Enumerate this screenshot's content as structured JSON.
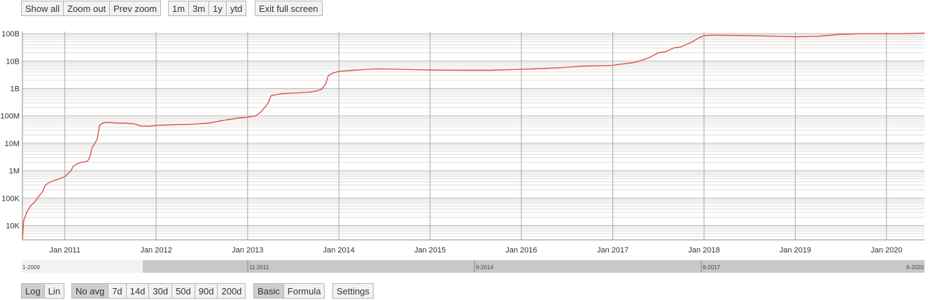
{
  "toolbar_top": {
    "zoom": [
      "Show all",
      "Zoom out",
      "Prev zoom"
    ],
    "ranges": [
      "1m",
      "3m",
      "1y",
      "ytd"
    ],
    "fullscreen": "Exit full screen"
  },
  "toolbar_bottom": {
    "scale": [
      "Log",
      "Lin"
    ],
    "averages": [
      "No avg",
      "7d",
      "14d",
      "30d",
      "50d",
      "90d",
      "200d"
    ],
    "mode": [
      "Basic",
      "Formula"
    ],
    "settings": "Settings",
    "active": [
      "Log",
      "No avg",
      "Basic"
    ]
  },
  "navigator": {
    "labels": [
      "1-2009",
      "11-2011",
      "9-2014",
      "8-2017",
      "6-2020"
    ]
  },
  "chart_data": {
    "type": "line",
    "yscale": "log",
    "ylim": [
      3000,
      120000000000
    ],
    "xlim": [
      "2010-07-15",
      "2020-06-01"
    ],
    "y_tick_labels": [
      "10K",
      "100K",
      "1M",
      "10M",
      "100M",
      "1B",
      "10B",
      "100B"
    ],
    "y_tick_values": [
      10000,
      100000,
      1000000,
      10000000,
      100000000,
      1000000000,
      10000000000,
      100000000000
    ],
    "x_tick_labels": [
      "Jan 2011",
      "Jan 2012",
      "Jan 2013",
      "Jan 2014",
      "Jan 2015",
      "Jan 2016",
      "Jan 2017",
      "Jan 2018",
      "Jan 2019",
      "Jan 2020"
    ],
    "x_tick_values": [
      "2011-01-01",
      "2012-01-01",
      "2013-01-01",
      "2014-01-01",
      "2015-01-01",
      "2016-01-01",
      "2017-01-01",
      "2018-01-01",
      "2019-01-01",
      "2020-01-01"
    ],
    "grid": true,
    "color": "#d9534f",
    "series": [
      {
        "x": [
          "2010-07-15",
          "2010-07-20",
          "2010-08-01",
          "2010-08-15",
          "2010-09-01",
          "2010-09-20",
          "2010-10-05",
          "2010-10-15",
          "2010-11-01",
          "2010-12-01",
          "2011-01-01",
          "2011-01-25",
          "2011-02-05",
          "2011-02-20",
          "2011-03-05",
          "2011-04-01",
          "2011-04-10",
          "2011-04-20",
          "2011-05-01",
          "2011-05-10",
          "2011-05-20",
          "2011-06-01",
          "2011-06-10",
          "2011-07-01",
          "2011-08-01",
          "2011-09-01",
          "2011-10-01",
          "2011-11-01",
          "2011-12-01",
          "2012-01-01",
          "2012-03-01",
          "2012-06-01",
          "2012-08-01",
          "2012-10-01",
          "2012-12-01",
          "2013-01-01",
          "2013-02-01",
          "2013-02-20",
          "2013-03-10",
          "2013-03-25",
          "2013-04-05",
          "2013-04-20",
          "2013-05-15",
          "2013-07-01",
          "2013-09-01",
          "2013-10-01",
          "2013-10-25",
          "2013-11-10",
          "2013-11-20",
          "2013-12-10",
          "2014-01-01",
          "2014-03-01",
          "2014-06-01",
          "2014-09-01",
          "2015-01-01",
          "2015-06-01",
          "2015-09-01",
          "2016-01-01",
          "2016-06-01",
          "2016-09-01",
          "2017-01-01",
          "2017-04-01",
          "2017-05-01",
          "2017-06-01",
          "2017-07-01",
          "2017-08-01",
          "2017-09-01",
          "2017-10-01",
          "2017-11-15",
          "2017-12-10",
          "2018-01-01",
          "2018-02-01",
          "2018-06-01",
          "2018-11-01",
          "2019-01-01",
          "2019-04-01",
          "2019-07-01",
          "2019-10-01",
          "2020-01-01",
          "2020-03-01",
          "2020-06-01"
        ],
        "y": [
          3000,
          15000,
          30000,
          50000,
          70000,
          120000,
          180000,
          300000,
          380000,
          480000,
          600000,
          1000000,
          1500000,
          1800000,
          2000000,
          2200000,
          3000000,
          7000000,
          10000000,
          14000000,
          45000000,
          55000000,
          58000000,
          57000000,
          55000000,
          54000000,
          52000000,
          43000000,
          42000000,
          45000000,
          47000000,
          50000000,
          55000000,
          70000000,
          85000000,
          90000000,
          100000000,
          130000000,
          200000000,
          300000000,
          550000000,
          580000000,
          640000000,
          680000000,
          720000000,
          800000000,
          950000000,
          1500000000,
          3000000000,
          3700000000,
          4200000000,
          4600000000,
          5200000000,
          5000000000,
          4700000000,
          4600000000,
          4600000000,
          5000000000,
          5700000000,
          6500000000,
          7000000000,
          9000000000,
          11000000000,
          14000000000,
          20000000000,
          22000000000,
          30000000000,
          33000000000,
          50000000000,
          70000000000,
          85000000000,
          88000000000,
          86000000000,
          80000000000,
          77000000000,
          80000000000,
          95000000000,
          100000000000,
          100000000000,
          100000000000,
          105000000000
        ]
      }
    ]
  }
}
